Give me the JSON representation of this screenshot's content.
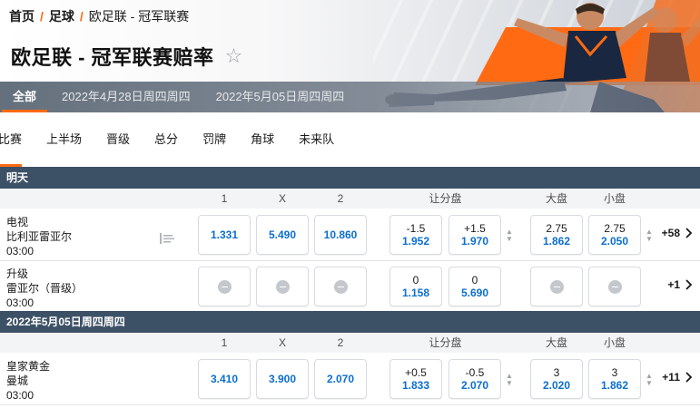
{
  "breadcrumb": {
    "home": "首页",
    "sport": "足球",
    "current": "欧足联 - 冠军联赛"
  },
  "page_title": "欧足联 - 冠军联赛赔率",
  "date_tabs": [
    "全部",
    "2022年4月28日周四周四",
    "2022年5月05日周四周四"
  ],
  "market_tabs": [
    "比赛",
    "上半场",
    "晋级",
    "总分",
    "罚牌",
    "角球",
    "未来队"
  ],
  "column_headers": {
    "home": "1",
    "draw": "X",
    "away": "2",
    "handicap": "让分盘",
    "over": "大盘",
    "under": "小盘"
  },
  "sections": [
    {
      "title": "明天",
      "matches": [
        {
          "team1": "电视",
          "team2": "比利亚雷亚尔",
          "time": "03:00",
          "odds_1": "1.331",
          "odds_x": "5.490",
          "odds_2": "10.860",
          "handicap_home_line": "-1.5",
          "handicap_home_price": "1.952",
          "handicap_away_line": "+1.5",
          "handicap_away_price": "1.970",
          "over_line": "2.75",
          "over_price": "1.862",
          "under_line": "2.75",
          "under_price": "2.050",
          "more": "+58"
        },
        {
          "team1": "升级",
          "team2": "雷亚尔（晋级）",
          "time": "03:00",
          "handicap_home_line": "0",
          "handicap_home_price": "1.158",
          "handicap_away_line": "0",
          "handicap_away_price": "5.690",
          "more": "+1"
        }
      ]
    },
    {
      "title": "2022年5月05日周四周四",
      "matches": [
        {
          "team1": "皇家黄金",
          "team2": "曼城",
          "time": "03:00",
          "odds_1": "3.410",
          "odds_x": "3.900",
          "odds_2": "2.070",
          "handicap_home_line": "+0.5",
          "handicap_home_price": "1.833",
          "handicap_away_line": "-0.5",
          "handicap_away_price": "2.070",
          "over_line": "3",
          "over_price": "2.020",
          "under_line": "3",
          "under_price": "1.862",
          "more": "+11"
        }
      ]
    }
  ],
  "colors": {
    "accent": "#ff6a13",
    "section_header": "#3d5166",
    "odds_price": "#0b6fcf"
  }
}
